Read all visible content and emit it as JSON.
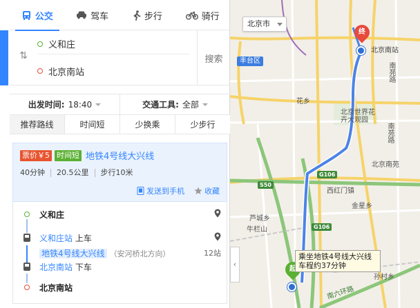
{
  "tabs": [
    {
      "label": "公交",
      "icon": "bus-icon",
      "active": true
    },
    {
      "label": "驾车",
      "icon": "car-icon",
      "active": false
    },
    {
      "label": "步行",
      "icon": "walk-icon",
      "active": false
    },
    {
      "label": "骑行",
      "icon": "bike-icon",
      "active": false
    }
  ],
  "search": {
    "origin": "义和庄",
    "destination": "北京南站",
    "button": "搜索"
  },
  "filters": {
    "depart_label": "出发时间:",
    "depart_value": "18:40",
    "tool_label": "交通工具:",
    "tool_value": "全部"
  },
  "sort_tabs": [
    "推荐路线",
    "时间短",
    "少换乘",
    "少步行"
  ],
  "plan": {
    "price_tag": "票价￥5",
    "fast_tag": "时间短",
    "title": "地铁4号线大兴线",
    "duration": "40分钟",
    "distance": "20.5公里",
    "walk": "步行10米",
    "send_label": "发送到手机",
    "fav_label": "收藏"
  },
  "steps": {
    "origin": "义和庄",
    "board_station": "义和庄站",
    "board_action": "上车",
    "line": "地铁4号线大兴线",
    "direction": "（安河桥北方向）",
    "stops": "12站",
    "alight_station": "北京南站",
    "alight_action": "下车",
    "destination": "北京南站"
  },
  "map": {
    "city": "北京市",
    "district": "丰台区",
    "station_end": "北京南站",
    "end_pin": "终",
    "start_pin": "起",
    "tooltip": "乘坐地铁4号线大兴线 车程约37分钟",
    "labels": {
      "beijing_south": "北京南站",
      "world_park_1": "北京世界花",
      "world_park_2": "卉大观园",
      "huaxiang": "花乡",
      "nanyuan_rd": "南苑路",
      "nanyuan_rd2": "南苑路",
      "beijing_nanyuan": "北京南苑",
      "xihongmen": "西红门镇",
      "jinxing": "金星乡",
      "lucheng_1": "芦城乡",
      "lucheng_2": "牛栏山",
      "sunxing": "孙村乡",
      "nanliuhuan": "南六环路",
      "g106a": "G106",
      "g106b": "G106",
      "s50": "S50"
    },
    "highway_color": "#3f8a3a",
    "route_color": "#4c84e6"
  },
  "colors": {
    "accent": "#3385ff",
    "price": "#e8542f",
    "fast": "#5ab031",
    "end": "#e84a3c"
  }
}
